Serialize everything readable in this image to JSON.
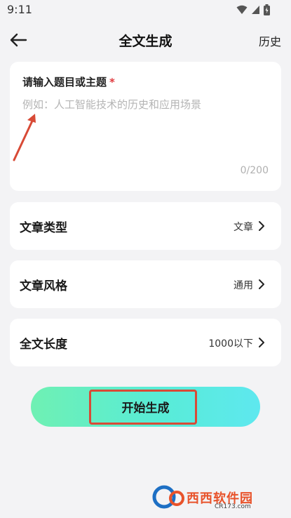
{
  "status_bar": {
    "time": "9:11",
    "icons": [
      "wifi-icon",
      "signal-icon",
      "battery-icon"
    ]
  },
  "header": {
    "title": "全文生成",
    "back_icon": "arrow-left-icon",
    "history_label": "历史"
  },
  "topic": {
    "label": "请输入题目或主题",
    "required_mark": "*",
    "value": "",
    "placeholder": "例如：人工智能技术的历史和应用场景",
    "char_count": "0/200"
  },
  "options": {
    "type": {
      "label": "文章类型",
      "value": "文章"
    },
    "style": {
      "label": "文章风格",
      "value": "通用"
    },
    "length": {
      "label": "全文长度",
      "value": "1000以下"
    }
  },
  "generate_button": {
    "label": "开始生成"
  },
  "watermark": {
    "text": "西西软件园",
    "sub": "CR173.com"
  },
  "colors": {
    "background": "#f3f3f5",
    "card": "#ffffff",
    "required": "#e0393e",
    "button_gradient_start": "#6ff0b3",
    "button_gradient_end": "#5ee8ef",
    "annotation": "#d84a36"
  }
}
